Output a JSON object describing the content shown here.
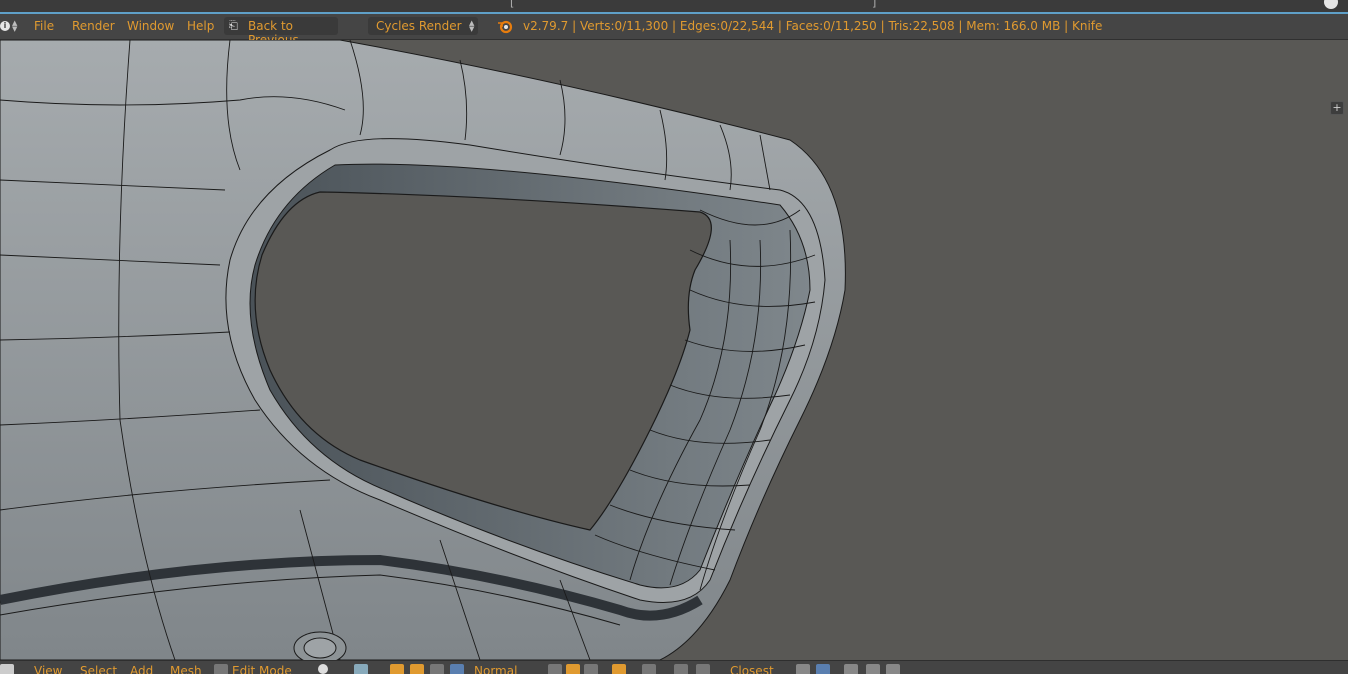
{
  "window": {
    "title_fragment": "[",
    "title_end": "]"
  },
  "menu": {
    "file": "File",
    "render": "Render",
    "window": "Window",
    "help": "Help"
  },
  "back_button": {
    "label": "Back to Previous"
  },
  "render_engine": {
    "selected": "Cycles Render"
  },
  "stats": {
    "text": "v2.79.7 | Verts:0/11,300 | Edges:0/22,544 | Faces:0/11,250 | Tris:22,508 | Mem: 166.0 MB | Knife"
  },
  "footer": {
    "view": "View",
    "select": "Select",
    "add": "Add",
    "mesh": "Mesh",
    "mode": "Edit Mode",
    "orientation": "Normal",
    "snap": "Closest"
  },
  "icons": {
    "info": "info-icon",
    "blender": "blender-logo-icon",
    "back": "back-arrow-icon",
    "plus": "plus-icon"
  },
  "colors": {
    "accent_text": "#e09a30",
    "header_bg": "#454545",
    "viewport_bg": "#595855",
    "mesh": "#8d9396",
    "wire": "#1a1a1a"
  }
}
